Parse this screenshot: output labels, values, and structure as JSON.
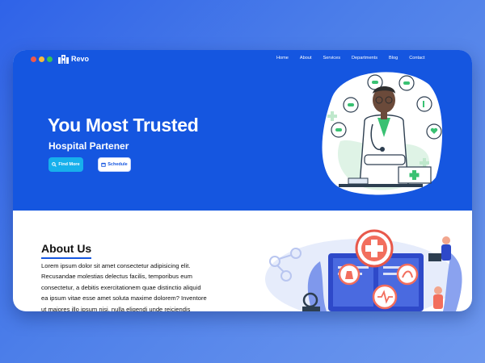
{
  "window": {
    "dots": [
      "#f0584a",
      "#f5b93e",
      "#38c456"
    ]
  },
  "brand": {
    "name": "Revo",
    "icon": "hospital-building-icon"
  },
  "nav": {
    "items": [
      {
        "label": "Home"
      },
      {
        "label": "About"
      },
      {
        "label": "Services"
      },
      {
        "label": "Departments"
      },
      {
        "label": "Blog"
      },
      {
        "label": "Contact"
      }
    ]
  },
  "hero": {
    "title": "You Most Trusted",
    "subtitle": "Hospital Partener",
    "find_more_label": "Find More",
    "find_more_icon": "search-icon",
    "schedule_label": "Schedule",
    "schedule_icon": "calendar-icon",
    "illustration": "doctor-illustration"
  },
  "about": {
    "title": "About Us",
    "lines": [
      "Lorem ipsum dolor sit amet consectetur adipisicing elit.",
      "Recusandae molestias delectus facilis, temporibus eum",
      "consectetur, a debitis exercitationem quae distinctio aliquid",
      "ea ipsum vitae esse amet soluta maxime dolorem? Inventore",
      "ut maiores illo ipsum nisi, nulla eligendi unde reiciendis"
    ],
    "illustration": "medical-research-illustration"
  },
  "colors": {
    "hero_bg": "#1556e0",
    "page_bg": "#ffffff",
    "accent": "#17b0ec"
  }
}
